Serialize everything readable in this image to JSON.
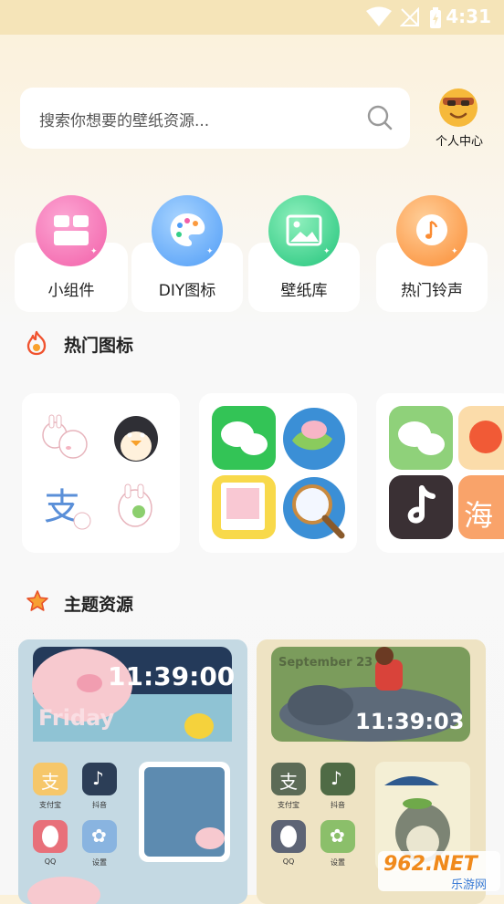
{
  "status_bar": {
    "time": "4:31"
  },
  "search": {
    "placeholder": "搜索你想要的壁纸资源..."
  },
  "profile": {
    "label": "个人中心"
  },
  "entries": [
    {
      "label": "小组件",
      "icon": "widgets-icon",
      "color": "#f56bb0"
    },
    {
      "label": "DIY图标",
      "icon": "palette-icon",
      "color": "#5aa4f7"
    },
    {
      "label": "壁纸库",
      "icon": "image-icon",
      "color": "#34cf88"
    },
    {
      "label": "热门铃声",
      "icon": "music-note-icon",
      "color": "#fb9a3e"
    }
  ],
  "sections": {
    "hot_icons": {
      "title": "热门图标",
      "icon": "flame-icon"
    },
    "themes": {
      "title": "主题资源",
      "icon": "star-icon"
    }
  },
  "themes": [
    {
      "clock": "11:39:00",
      "day": "Friday",
      "apps": [
        {
          "label": "支付宝",
          "glyph": "支"
        },
        {
          "label": "抖音",
          "glyph": "♪"
        },
        {
          "label": "QQ",
          "glyph": ""
        },
        {
          "label": "设置",
          "glyph": "✿"
        }
      ]
    },
    {
      "clock": "11:39:03",
      "date": "September 23",
      "apps": [
        {
          "label": "支付宝",
          "glyph": "支"
        },
        {
          "label": "抖音",
          "glyph": "♪"
        },
        {
          "label": "QQ",
          "glyph": ""
        },
        {
          "label": "设置",
          "glyph": "✿"
        }
      ]
    }
  ],
  "watermark": {
    "text": "962.NET",
    "subtext": "乐游网"
  }
}
